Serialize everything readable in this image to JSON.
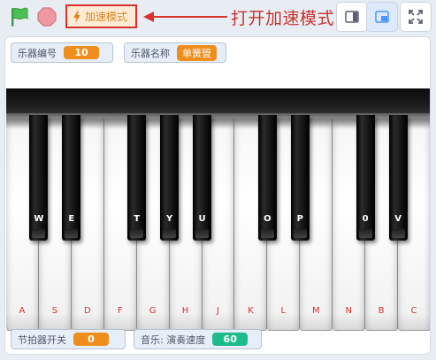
{
  "toolbar": {
    "flag_icon": "green-flag-icon",
    "stop_icon": "stop-icon",
    "turbo_label": "加速模式",
    "annotation": "打开加速模式",
    "small_stage_icon": "small-stage-icon",
    "large_stage_icon": "large-stage-icon",
    "fullscreen_icon": "fullscreen-icon"
  },
  "monitors": {
    "instrument_number": {
      "label": "乐器编号",
      "value": "10"
    },
    "instrument_name": {
      "label": "乐器名称",
      "value": "单簧管"
    },
    "metronome": {
      "label": "节拍器开关",
      "value": "0"
    },
    "tempo": {
      "label": "音乐: 演奏速度",
      "value": "60"
    }
  },
  "piano": {
    "white_keys": [
      "A",
      "S",
      "D",
      "F",
      "G",
      "H",
      "J",
      "K",
      "L",
      "M",
      "N",
      "B",
      "C"
    ],
    "black_keys": [
      "W",
      "E",
      "T",
      "Y",
      "U",
      "O",
      "P",
      "0",
      "V"
    ]
  },
  "colors": {
    "accent_red": "#d8322b",
    "monitor_orange": "#ef8e1d",
    "monitor_teal": "#1ebc8c",
    "flag_green": "#4cbf56"
  }
}
